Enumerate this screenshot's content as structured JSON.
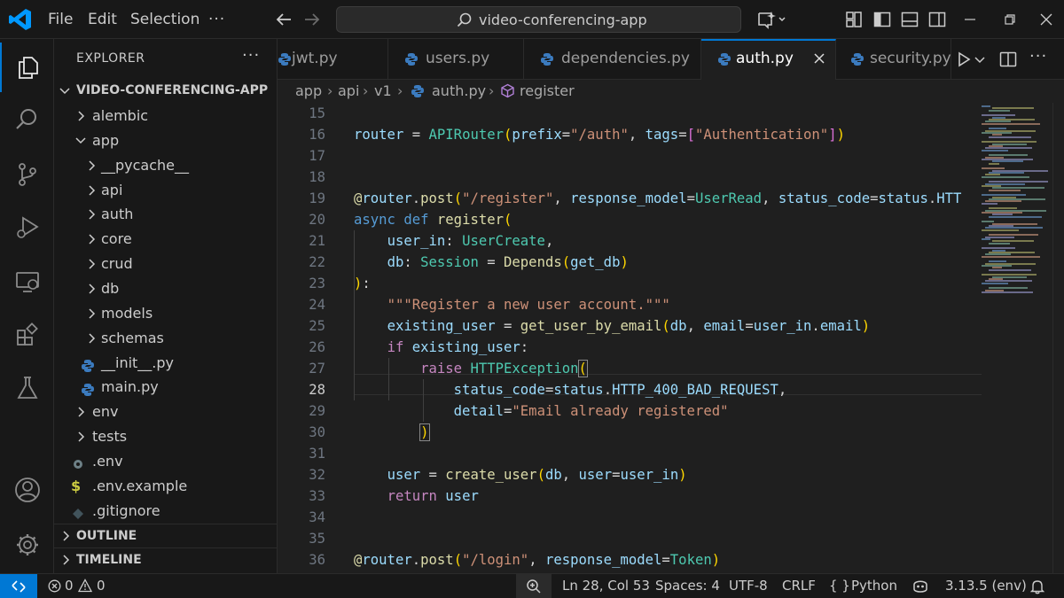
{
  "titlebar": {
    "menu": [
      "File",
      "Edit",
      "Selection"
    ],
    "more": "···",
    "search_text": "video-conferencing-app"
  },
  "activity_bar": {
    "items": [
      "explorer-icon",
      "search-icon",
      "source-control-icon",
      "run-debug-icon",
      "remote-explorer-icon",
      "extensions-icon",
      "testing-icon"
    ],
    "bottom": [
      "accounts-icon",
      "manage-gear-icon"
    ]
  },
  "explorer": {
    "title": "EXPLORER",
    "more": "···",
    "root": "VIDEO-CONFERENCING-APP",
    "items": [
      {
        "label": "alembic",
        "type": "folder",
        "state": "collapsed"
      },
      {
        "label": "app",
        "type": "folder",
        "state": "expanded"
      },
      {
        "label": "__pycache__",
        "type": "folder",
        "state": "collapsed"
      },
      {
        "label": "api",
        "type": "folder",
        "state": "collapsed"
      },
      {
        "label": "auth",
        "type": "folder",
        "state": "collapsed"
      },
      {
        "label": "core",
        "type": "folder",
        "state": "collapsed"
      },
      {
        "label": "crud",
        "type": "folder",
        "state": "collapsed"
      },
      {
        "label": "db",
        "type": "folder",
        "state": "collapsed"
      },
      {
        "label": "models",
        "type": "folder",
        "state": "collapsed"
      },
      {
        "label": "schemas",
        "type": "folder",
        "state": "collapsed"
      },
      {
        "label": "__init__.py",
        "type": "python"
      },
      {
        "label": "main.py",
        "type": "python"
      },
      {
        "label": "env",
        "type": "folder",
        "state": "collapsed"
      },
      {
        "label": "tests",
        "type": "folder",
        "state": "collapsed"
      },
      {
        "label": ".env",
        "type": "settings"
      },
      {
        "label": ".env.example",
        "type": "dollar"
      },
      {
        "label": ".gitignore",
        "type": "git"
      }
    ],
    "outline": "OUTLINE",
    "timeline": "TIMELINE"
  },
  "tabs": [
    {
      "label": "jwt.py",
      "active": false
    },
    {
      "label": "users.py",
      "active": false
    },
    {
      "label": "dependencies.py",
      "active": false
    },
    {
      "label": "auth.py",
      "active": true
    },
    {
      "label": "security.py",
      "active": false
    }
  ],
  "breadcrumb": [
    "app",
    "api",
    "v1",
    "auth.py",
    "register"
  ],
  "editor": {
    "current_line": 28,
    "line_numbers": [
      "15",
      "16",
      "17",
      "18",
      "19",
      "20",
      "21",
      "22",
      "23",
      "24",
      "25",
      "26",
      "27",
      "28",
      "29",
      "30",
      "31",
      "32",
      "33",
      "34",
      "35",
      "36"
    ],
    "code_lines": [
      "",
      "router = APIRouter(prefix=\"/auth\", tags=[\"Authentication\"])",
      "",
      "",
      "@router.post(\"/register\", response_model=UserRead, status_code=status.HTT",
      "async def register(",
      "    user_in: UserCreate,",
      "    db: Session = Depends(get_db)",
      "):",
      "    \"\"\"Register a new user account.\"\"\"",
      "    existing_user = get_user_by_email(db, email=user_in.email)",
      "    if existing_user:",
      "        raise HTTPException(",
      "            status_code=status.HTTP_400_BAD_REQUEST,",
      "            detail=\"Email already registered\"",
      "        )",
      "",
      "    user = create_user(db, user=user_in)",
      "    return user",
      "",
      "",
      "@router.post(\"/login\", response_model=Token)"
    ]
  },
  "statusbar": {
    "errors": "0",
    "warnings": "0",
    "position": "Ln 28, Col 53",
    "spaces": "Spaces: 4",
    "encoding": "UTF-8",
    "eol": "CRLF",
    "language": "Python",
    "language_prefix": "{ }",
    "interpreter": "3.13.5 (env)"
  },
  "colors": {
    "accent": "#0078d4",
    "background": "#1f1f1f",
    "sidebar": "#181818"
  }
}
